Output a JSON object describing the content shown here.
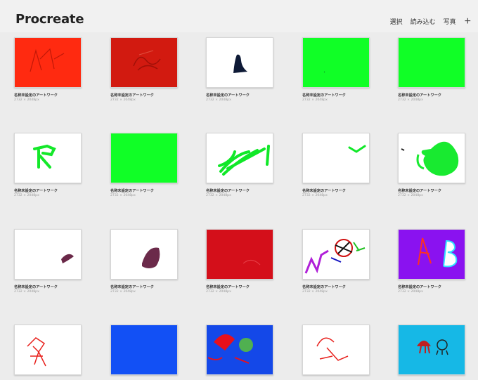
{
  "app": {
    "title": "Procreate"
  },
  "toolbar": {
    "select_label": "選択",
    "import_label": "読み込む",
    "photo_label": "写真",
    "add_label": "+"
  },
  "artworks": [
    {
      "title": "名称未設定のアートワーク",
      "size": "2732 × 2048px",
      "background": "#ff2a10",
      "content": "red scribble"
    },
    {
      "title": "名称未設定のアートワーク",
      "size": "2732 × 2048px",
      "background": "#d21a10",
      "content": "dark red scribble"
    },
    {
      "title": "名称未設定のアートワーク",
      "size": "2732 × 2048px",
      "background": "#ffffff",
      "content": "navy shape"
    },
    {
      "title": "名称未設定のアートワーク",
      "size": "2732 × 2048px",
      "background": "#10ff26",
      "content": "green fill"
    },
    {
      "title": "名称未設定のアートワーク",
      "size": "2732 × 2048px",
      "background": "#10ff26",
      "content": "green fill"
    },
    {
      "title": "名称未設定のアートワーク",
      "size": "2732 × 2048px",
      "background": "#ffffff",
      "content": "green R figure"
    },
    {
      "title": "名称未設定のアートワーク",
      "size": "2732 × 2048px",
      "background": "#10ff26",
      "content": "green fill"
    },
    {
      "title": "名称未設定のアートワーク",
      "size": "2732 × 2048px",
      "background": "#ffffff",
      "content": "green scribbles"
    },
    {
      "title": "名称未設定のアートワーク",
      "size": "2732 × 2048px",
      "background": "#ffffff",
      "content": "green stroke"
    },
    {
      "title": "名称未設定のアートワーク",
      "size": "2732 × 2048px",
      "background": "#ffffff",
      "content": "green blob"
    },
    {
      "title": "名称未設定のアートワーク",
      "size": "2732 × 2048px",
      "background": "#ffffff",
      "content": "purple dot"
    },
    {
      "title": "名称未設定のアートワーク",
      "size": "2732 × 2048px",
      "background": "#ffffff",
      "content": "purple blob"
    },
    {
      "title": "名称未設定のアートワーク",
      "size": "2732 × 2048px",
      "background": "#d40f1a",
      "content": "red fill"
    },
    {
      "title": "名称未設定のアートワーク",
      "size": "2732 × 2048px",
      "background": "#ffffff",
      "content": "multicolor doodle"
    },
    {
      "title": "名称未設定のアートワーク",
      "size": "2732 × 2048px",
      "background": "#8a12f0",
      "content": "purple with letters"
    },
    {
      "title": "",
      "size": "",
      "background": "#ffffff",
      "content": "red figure"
    },
    {
      "title": "",
      "size": "",
      "background": "#1250f5",
      "content": "blue fill"
    },
    {
      "title": "",
      "size": "",
      "background": "#1448e8",
      "content": "blue with red and green"
    },
    {
      "title": "",
      "size": "",
      "background": "#ffffff",
      "content": "red doodle"
    },
    {
      "title": "",
      "size": "",
      "background": "#16b8e6",
      "content": "cyan with creatures"
    }
  ]
}
